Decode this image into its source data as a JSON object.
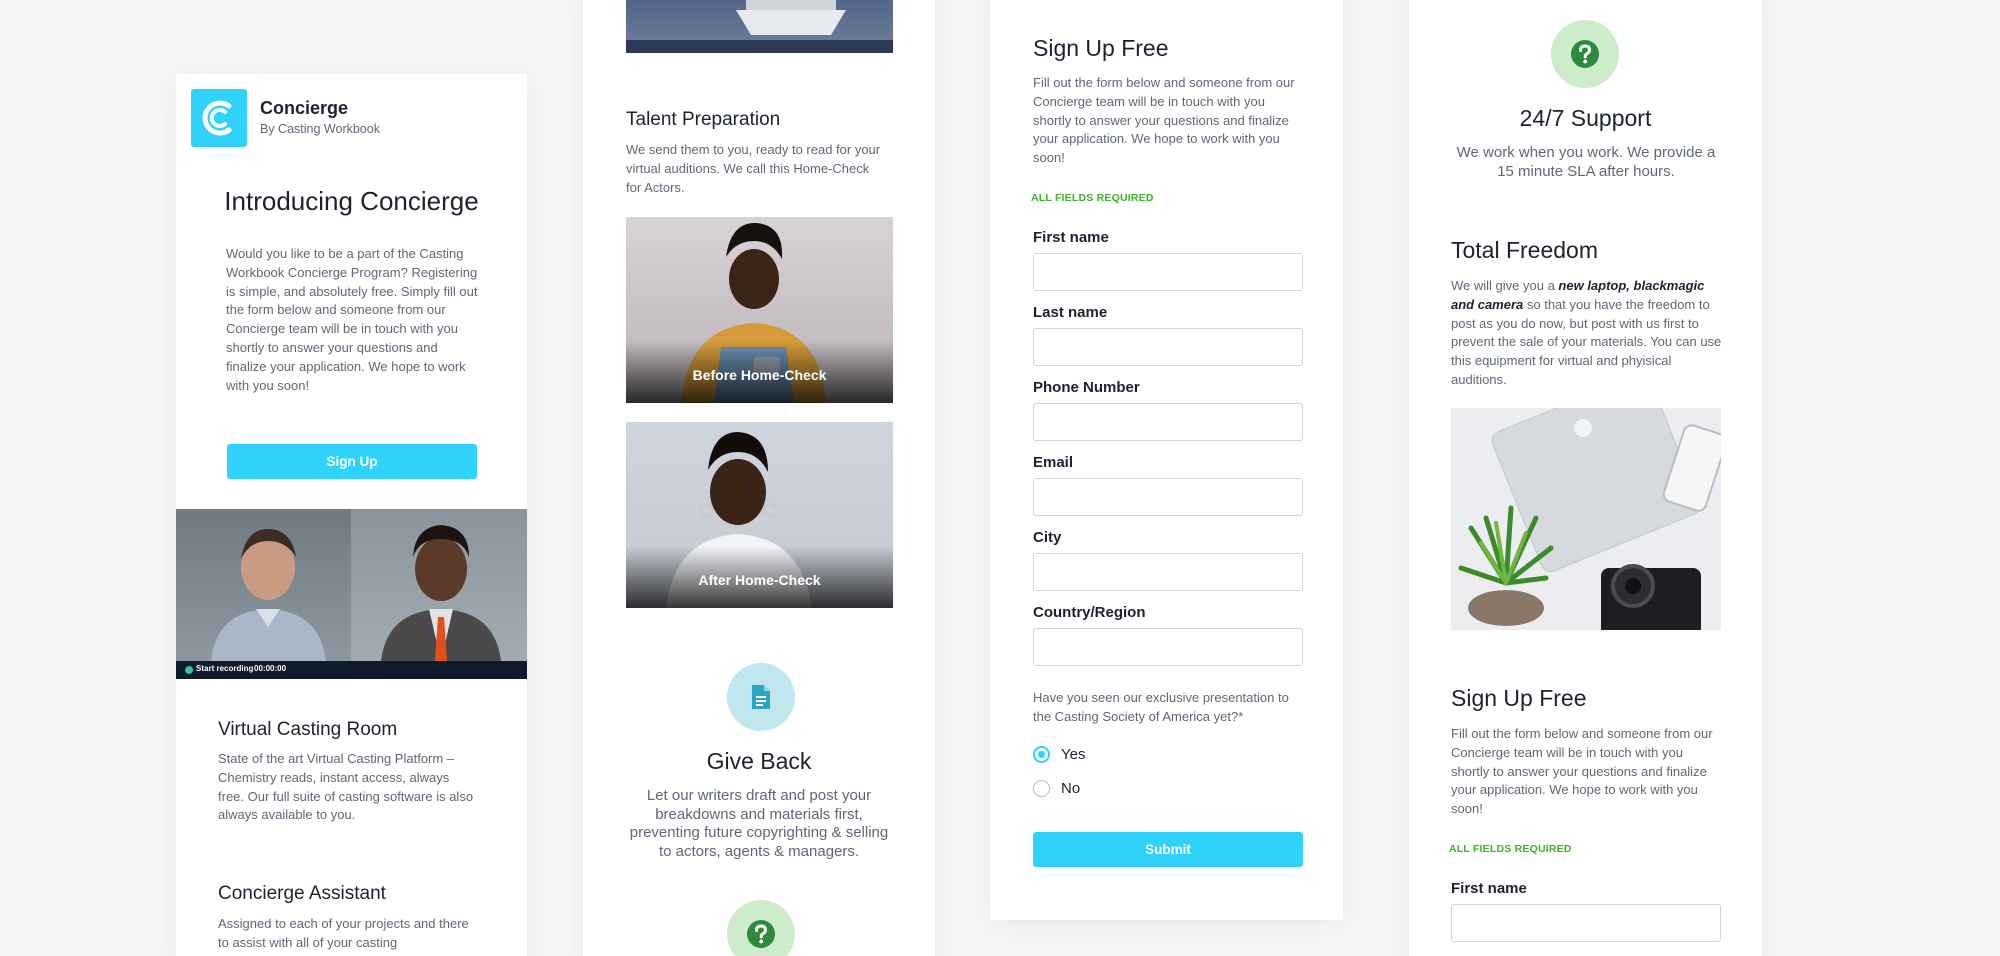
{
  "colors": {
    "accent": "#2fd2fa",
    "required_green": "#3fb02c",
    "doc_icon": "#2aa6c4",
    "help_icon": "#2e8b3e",
    "background": "#f5f6f8"
  },
  "panel1": {
    "app_name": "Concierge",
    "app_byline": "By Casting Workbook",
    "title": "Introducing Concierge",
    "intro": "Would you like to be a part of the Casting Workbook Concierge Program? Registering is simple, and absolutely free. Simply fill out the form below and someone from our Concierge team will be in touch with you shortly to answer your questions and finalize your application.  We hope to work with you soon!",
    "signup_button": "Sign Up",
    "video_status": "Start recording",
    "video_timer": "00:00:00",
    "virtual_room_title": "Virtual Casting Room",
    "virtual_room_text": "State of the art Virtual Casting Platform – Chemistry reads, instant access, always free.   Our full suite of casting software is also always available to you.",
    "assistant_title": "Concierge Assistant",
    "assistant_text": "Assigned to each of your projects and there to assist with all of your casting"
  },
  "panel2": {
    "talent_title": "Talent Preparation",
    "talent_text": "We send them to you, ready to read for your virtual auditions. We call this Home-Check for Actors.",
    "before_caption": "Before Home-Check",
    "after_caption": "After Home-Check",
    "give_back_title": "Give Back",
    "give_back_text": "Let our writers draft and post your breakdowns and materials first, preventing future copyrighting & selling to actors, agents & managers.",
    "doc_icon": "document-icon",
    "help_icon": "question-icon"
  },
  "panel3": {
    "title": "Sign Up Free",
    "intro": "Fill out the form below and someone from our Concierge team will be in touch with you shortly to answer your questions and finalize your application.  We hope to work with you soon!",
    "required_note": "ALL FIELDS REQUIRED",
    "fields": {
      "first_name": {
        "label": "First name",
        "value": ""
      },
      "last_name": {
        "label": "Last name",
        "value": ""
      },
      "phone": {
        "label": "Phone Number",
        "value": ""
      },
      "email": {
        "label": "Email",
        "value": ""
      },
      "city": {
        "label": "City",
        "value": ""
      },
      "country": {
        "label": "Country/Region",
        "value": ""
      }
    },
    "question": "Have you seen our exclusive presentation to the Casting Society of America yet?*",
    "option_yes": "Yes",
    "option_no": "No",
    "selected": "Yes",
    "submit_button": "Submit"
  },
  "panel4": {
    "support_title": "24/7 Support",
    "support_text": "We work when you work. We provide a 15 minute SLA after hours.",
    "freedom_title": "Total Freedom",
    "freedom_text_a": "We will give you a ",
    "freedom_text_bold": "new laptop, blackmagic and camera",
    "freedom_text_b": " so that you have the freedom to post as you do now, but post with us first to prevent the sale of your materials. You can use this equipment for virtual and phyisical auditions.",
    "signup_title": "Sign Up Free",
    "signup_text": "Fill out the form below and someone from our Concierge team will be in touch with you shortly to answer your questions and finalize your application.  We hope to work with you soon!",
    "required_note": "ALL FIELDS REQUIRED",
    "first_name_label": "First name",
    "first_name_value": "",
    "help_icon": "question-icon"
  }
}
